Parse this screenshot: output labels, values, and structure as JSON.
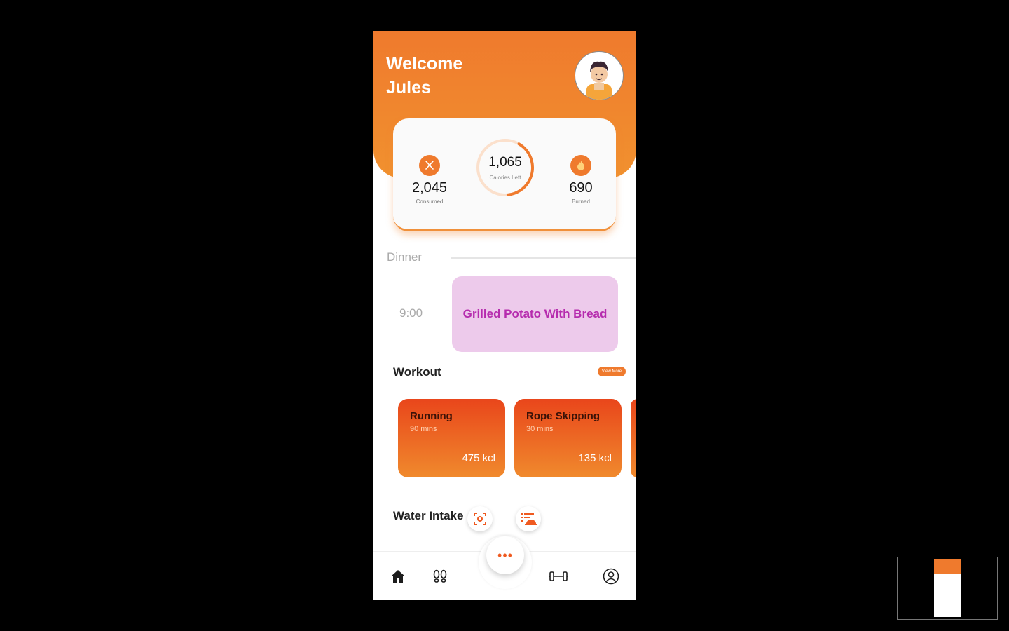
{
  "header": {
    "welcome": "Welcome\nJules"
  },
  "calories": {
    "left_value": "1,065",
    "left_label": "Calories Left",
    "consumed_value": "2,045",
    "consumed_label": "Consumed",
    "burned_value": "690",
    "burned_label": "Burned",
    "progress": 0.4
  },
  "dinner": {
    "label": "Dinner",
    "time": "9:00",
    "meal": "Grilled Potato With Bread"
  },
  "workout": {
    "title": "Workout",
    "view_more": "View More",
    "cards": [
      {
        "name": "Running",
        "duration": "90 mins",
        "kcal": "475 kcl"
      },
      {
        "name": "Rope Skipping",
        "duration": "30 mins",
        "kcal": "135 kcl"
      }
    ]
  },
  "water": {
    "title": "Water Intake"
  },
  "fab": {
    "label": "•••"
  },
  "colors": {
    "accent": "#ef7a2d",
    "meal_bg": "#edcaeb",
    "meal_text": "#b62cae"
  }
}
